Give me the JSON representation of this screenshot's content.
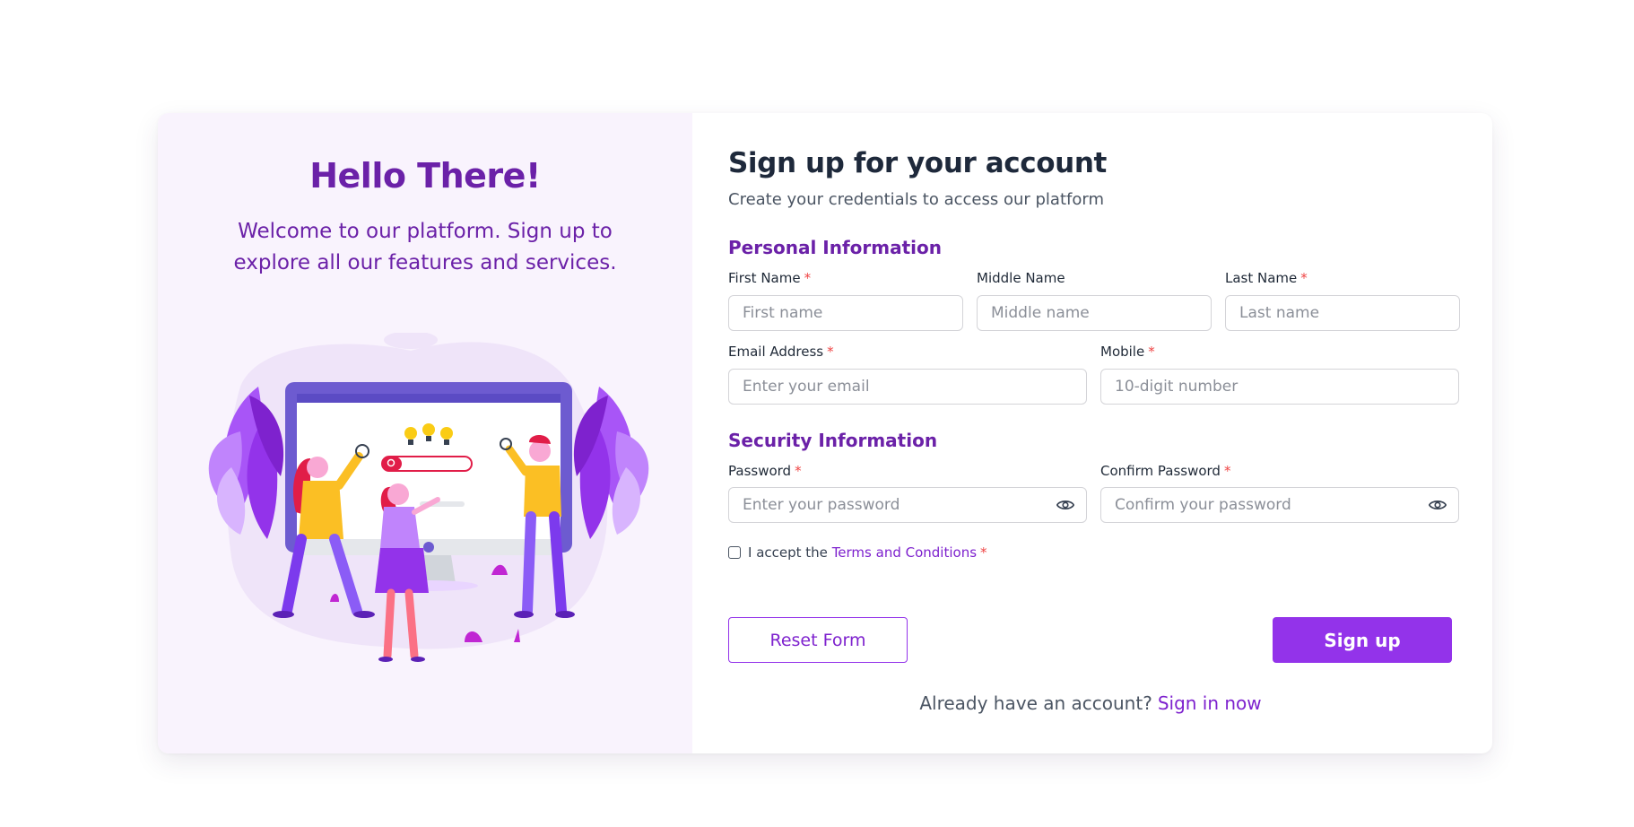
{
  "welcome": {
    "title": "Hello There!",
    "message": "Welcome to our platform. Sign up to explore all our features and services."
  },
  "form": {
    "title": "Sign up for your account",
    "subtitle": "Create your credentials to access our platform",
    "personal_section": "Personal Information",
    "security_section": "Security Information",
    "fields": {
      "first_name": {
        "label": "First Name",
        "placeholder": "First name",
        "required": "*"
      },
      "middle_name": {
        "label": "Middle Name",
        "placeholder": "Middle name"
      },
      "last_name": {
        "label": "Last Name",
        "placeholder": "Last name",
        "required": "*"
      },
      "email": {
        "label": "Email Address",
        "placeholder": "Enter your email",
        "required": "*"
      },
      "mobile": {
        "label": "Mobile",
        "placeholder": "10-digit number",
        "required": "*"
      },
      "password": {
        "label": "Password",
        "placeholder": "Enter your password",
        "required": "*"
      },
      "confirm_password": {
        "label": "Confirm Password",
        "placeholder": "Confirm your password",
        "required": "*"
      }
    },
    "terms": {
      "prefix": "I accept the",
      "link": "Terms and Conditions",
      "required": "*"
    },
    "reset_label": "Reset Form",
    "submit_label": "Sign up",
    "signin_prompt": "Already have an account?",
    "signin_link": "Sign in now"
  },
  "icons": {
    "password_toggle": "eye-icon",
    "confirm_password_toggle": "eye-icon"
  },
  "colors": {
    "accent": "#9333ea",
    "heading_purple": "#6b21a8",
    "left_panel_bg": "#f9f3fd",
    "required": "#ef4444"
  }
}
